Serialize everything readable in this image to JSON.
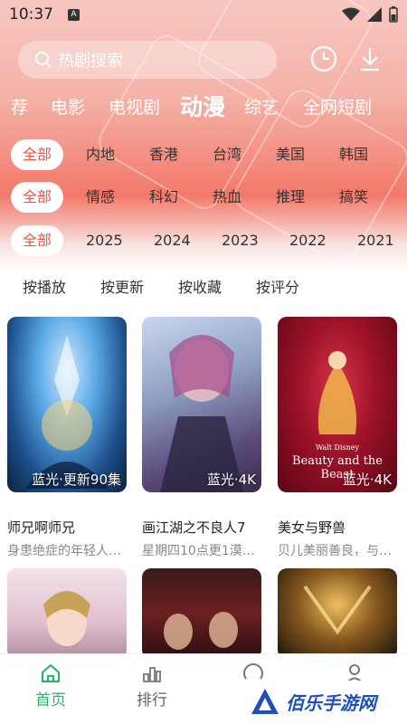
{
  "status_bar": {
    "time": "10:37",
    "badge": "A"
  },
  "search": {
    "placeholder": "热剧搜索"
  },
  "nav_tabs": [
    {
      "label": "荐"
    },
    {
      "label": "电影"
    },
    {
      "label": "电视剧"
    },
    {
      "label": "动漫",
      "active": true
    },
    {
      "label": "综艺"
    },
    {
      "label": "全网短剧"
    }
  ],
  "filters": {
    "region": [
      "全部",
      "内地",
      "香港",
      "台湾",
      "美国",
      "韩国"
    ],
    "genre": [
      "全部",
      "情感",
      "科幻",
      "热血",
      "推理",
      "搞笑"
    ],
    "year": [
      "全部",
      "2025",
      "2024",
      "2023",
      "2022",
      "2021"
    ]
  },
  "sort": [
    "按播放",
    "按更新",
    "按收藏",
    "按评分"
  ],
  "cards": [
    {
      "title": "师兄啊师兄",
      "subtitle": "身患绝症的年轻人…",
      "badge": "蓝光·更新90集"
    },
    {
      "title": "画江湖之不良人7",
      "subtitle": "星期四10点更1漠北…",
      "badge": "蓝光·4K"
    },
    {
      "title": "美女与野兽",
      "subtitle": "贝儿美丽善良，与…",
      "badge": "蓝光·4K",
      "poster_text": "Beauty and the Beast",
      "poster_brand": "Walt Disney"
    },
    {
      "title": "",
      "subtitle": "",
      "badge": ""
    },
    {
      "title": "",
      "subtitle": "",
      "badge": ""
    },
    {
      "title": "",
      "subtitle": "",
      "badge": ""
    }
  ],
  "bottom_nav": [
    {
      "label": "首页",
      "active": true
    },
    {
      "label": "排行"
    },
    {
      "label": ""
    },
    {
      "label": ""
    }
  ],
  "watermark": {
    "text": "佰乐手游网"
  },
  "colors": {
    "accent_red": "#f2523f",
    "accent_green": "#28b463",
    "watermark_blue": "#1f4fb8"
  }
}
